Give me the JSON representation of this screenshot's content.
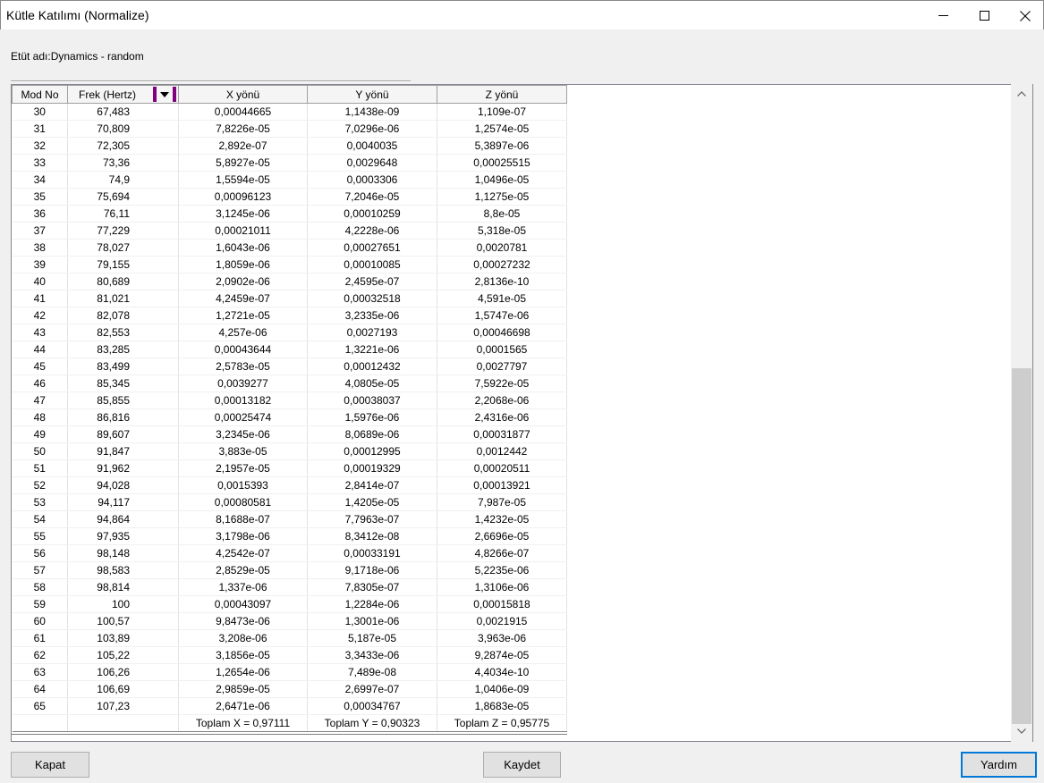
{
  "window": {
    "title": "Kütle Katılımı (Normalize)"
  },
  "study_label": "Etüt adı:Dynamics - random",
  "table": {
    "headers": [
      "Mod No",
      "Frek (Hertz)",
      "X yönü",
      "Y yönü",
      "Z yönü"
    ],
    "rows": [
      [
        "30",
        "67,483",
        "0,00044665",
        "1,1438e-09",
        "1,109e-07"
      ],
      [
        "31",
        "70,809",
        "7,8226e-05",
        "7,0296e-06",
        "1,2574e-05"
      ],
      [
        "32",
        "72,305",
        "2,892e-07",
        "0,0040035",
        "5,3897e-06"
      ],
      [
        "33",
        "73,36",
        "5,8927e-05",
        "0,0029648",
        "0,00025515"
      ],
      [
        "34",
        "74,9",
        "1,5594e-05",
        "0,0003306",
        "1,0496e-05"
      ],
      [
        "35",
        "75,694",
        "0,00096123",
        "7,2046e-05",
        "1,1275e-05"
      ],
      [
        "36",
        "76,11",
        "3,1245e-06",
        "0,00010259",
        "8,8e-05"
      ],
      [
        "37",
        "77,229",
        "0,00021011",
        "4,2228e-06",
        "5,318e-05"
      ],
      [
        "38",
        "78,027",
        "1,6043e-06",
        "0,00027651",
        "0,0020781"
      ],
      [
        "39",
        "79,155",
        "1,8059e-06",
        "0,00010085",
        "0,00027232"
      ],
      [
        "40",
        "80,689",
        "2,0902e-06",
        "2,4595e-07",
        "2,8136e-10"
      ],
      [
        "41",
        "81,021",
        "4,2459e-07",
        "0,00032518",
        "4,591e-05"
      ],
      [
        "42",
        "82,078",
        "1,2721e-05",
        "3,2335e-06",
        "1,5747e-06"
      ],
      [
        "43",
        "82,553",
        "4,257e-06",
        "0,0027193",
        "0,00046698"
      ],
      [
        "44",
        "83,285",
        "0,00043644",
        "1,3221e-06",
        "0,0001565"
      ],
      [
        "45",
        "83,499",
        "2,5783e-05",
        "0,00012432",
        "0,0027797"
      ],
      [
        "46",
        "85,345",
        "0,0039277",
        "4,0805e-05",
        "7,5922e-05"
      ],
      [
        "47",
        "85,855",
        "0,00013182",
        "0,00038037",
        "2,2068e-06"
      ],
      [
        "48",
        "86,816",
        "0,00025474",
        "1,5976e-06",
        "2,4316e-06"
      ],
      [
        "49",
        "89,607",
        "3,2345e-06",
        "8,0689e-06",
        "0,00031877"
      ],
      [
        "50",
        "91,847",
        "3,883e-05",
        "0,00012995",
        "0,0012442"
      ],
      [
        "51",
        "91,962",
        "2,1957e-05",
        "0,00019329",
        "0,00020511"
      ],
      [
        "52",
        "94,028",
        "0,0015393",
        "2,8414e-07",
        "0,00013921"
      ],
      [
        "53",
        "94,117",
        "0,00080581",
        "1,4205e-05",
        "7,987e-05"
      ],
      [
        "54",
        "94,864",
        "8,1688e-07",
        "7,7963e-07",
        "1,4232e-05"
      ],
      [
        "55",
        "97,935",
        "3,1798e-06",
        "8,3412e-08",
        "2,6696e-05"
      ],
      [
        "56",
        "98,148",
        "4,2542e-07",
        "0,00033191",
        "4,8266e-07"
      ],
      [
        "57",
        "98,583",
        "2,8529e-05",
        "9,1718e-06",
        "5,2235e-06"
      ],
      [
        "58",
        "98,814",
        "1,337e-06",
        "7,8305e-07",
        "1,3106e-06"
      ],
      [
        "59",
        "100",
        "0,00043097",
        "1,2284e-06",
        "0,00015818"
      ],
      [
        "60",
        "100,57",
        "9,8473e-06",
        "1,3001e-06",
        "0,0021915"
      ],
      [
        "61",
        "103,89",
        "3,208e-06",
        "5,187e-05",
        "3,963e-06"
      ],
      [
        "62",
        "105,22",
        "3,1856e-05",
        "3,3433e-06",
        "9,2874e-05"
      ],
      [
        "63",
        "106,26",
        "1,2654e-06",
        "7,489e-08",
        "4,4034e-10"
      ],
      [
        "64",
        "106,69",
        "2,9859e-05",
        "2,6997e-07",
        "1,0406e-09"
      ],
      [
        "65",
        "107,23",
        "2,6471e-06",
        "0,00034767",
        "1,8683e-05"
      ]
    ],
    "totals": [
      "Toplam X = 0,97111",
      "Toplam Y = 0,90323",
      "Toplam Z = 0,95775"
    ]
  },
  "buttons": {
    "close": "Kapat",
    "save": "Kaydet",
    "help": "Yardım"
  },
  "colors": {
    "filter_accent": "#800080",
    "default_button_border": "#0078d7"
  }
}
